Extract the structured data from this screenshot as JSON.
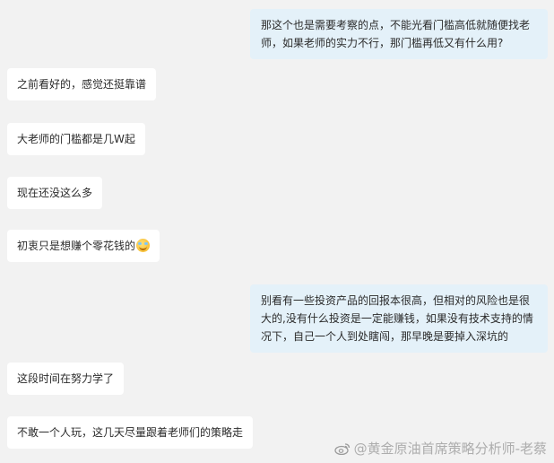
{
  "messages": [
    {
      "side": "me",
      "text": "那这个也是需要考察的点，不能光看门槛高低就随便找老师，如果老师的实力不行，那门槛再低又有什么用?"
    },
    {
      "side": "other",
      "text": "之前看好的，感觉还挺靠谱"
    },
    {
      "side": "other",
      "text": "大老师的门槛都是几W起"
    },
    {
      "side": "other",
      "text": "现在还没这么多"
    },
    {
      "side": "other",
      "text": "初衷只是想赚个零花钱的",
      "emoji": "laughing-tears-emoji"
    },
    {
      "side": "me",
      "text": "别看有一些投资产品的回报本很高，但相对的风险也是很大的,没有什么投资是一定能赚钱，如果没有技术支持的情况下，自己一个人到处瞎闯，那早晚是要掉入深坑的"
    },
    {
      "side": "other",
      "text": "这段时间在努力学了"
    },
    {
      "side": "other",
      "text": "不敢一个人玩，这几天尽量跟着老师们的策略走"
    }
  ],
  "watermark": {
    "icon": "weibo-icon",
    "text": "@黄金原油首席策略分析师-老蔡"
  }
}
